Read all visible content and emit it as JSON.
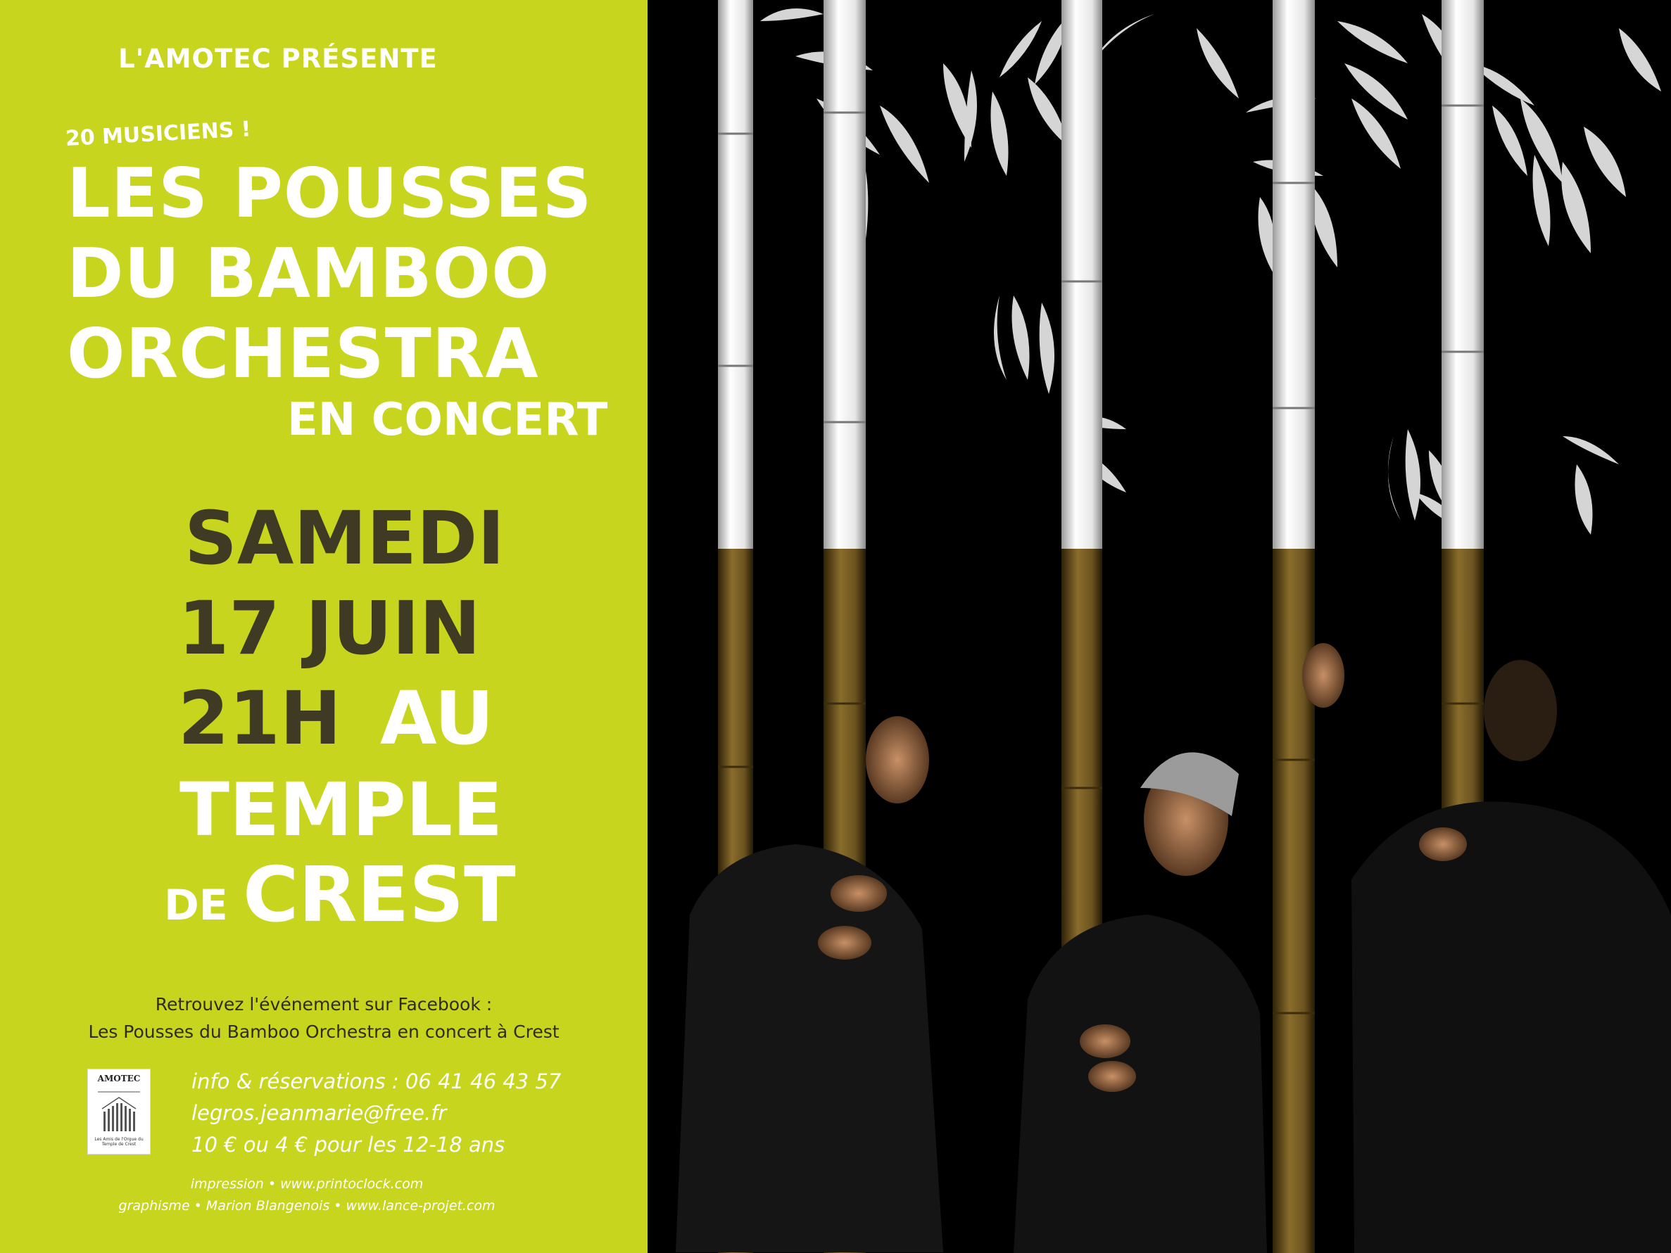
{
  "poster": {
    "presenter": "L'AMOTEC PRÉSENTE",
    "musicians_tag": "20 MUSICIENS !",
    "title_line1": "LES POUSSES",
    "title_line2": "DU BAMBOO",
    "title_line3": "ORCHESTRA",
    "subtitle": "EN CONCERT",
    "day": "SAMEDI",
    "date": "17 JUIN",
    "time": "21H",
    "au": "AU",
    "venue_line1": "TEMPLE",
    "venue_de": "DE",
    "venue_city": "CREST"
  },
  "facebook": {
    "line1": "Retrouvez l'événement sur Facebook :",
    "line2": "Les Pousses du Bamboo Orchestra en concert à Crest"
  },
  "logo": {
    "name": "AMOTEC",
    "caption": "Les Amis de l'Orgue du Temple de Crest"
  },
  "contact": {
    "info": "info & réservations : 06 41 46 43 57",
    "email": "legros.jeanmarie@free.fr",
    "prices": "10 € ou 4 € pour les 12-18 ans"
  },
  "credits": {
    "print": "impression • www.printoclock.com",
    "design": "graphisme • Marion Blangenois • www.lance-projet.com"
  },
  "colors": {
    "panel_green": "#c7d51f",
    "dark_text": "#3f3a23",
    "background": "#000000",
    "bamboo_white": "#f2f2f2",
    "bamboo_brown": "#6b5320"
  }
}
